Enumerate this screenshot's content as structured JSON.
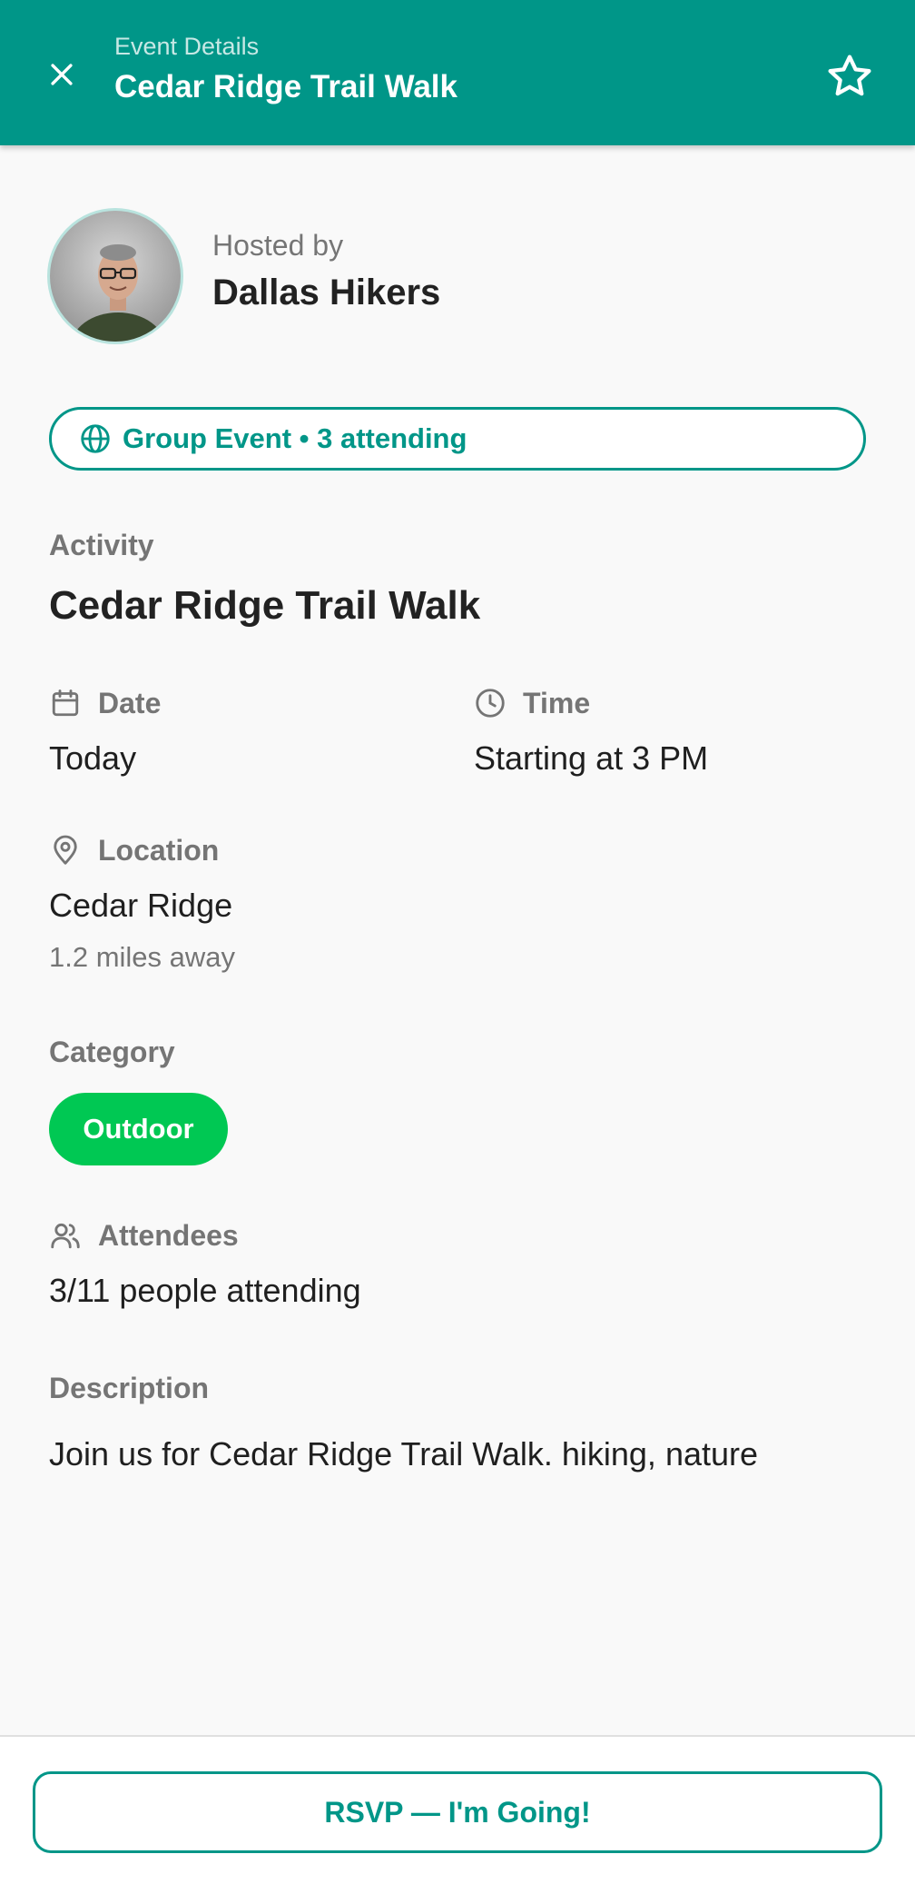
{
  "header": {
    "subtitle": "Event Details",
    "title": "Cedar Ridge Trail Walk",
    "close_icon": "close-icon",
    "star_icon": "star-outline-icon"
  },
  "host": {
    "label": "Hosted by",
    "name": "Dallas Hikers"
  },
  "group_badge": {
    "icon": "globe-icon",
    "text": "Group Event • 3 attending"
  },
  "activity": {
    "label": "Activity",
    "title": "Cedar Ridge Trail Walk"
  },
  "date": {
    "icon": "calendar-icon",
    "label": "Date",
    "value": "Today"
  },
  "time": {
    "icon": "clock-icon",
    "label": "Time",
    "value": "Starting at 3 PM"
  },
  "location": {
    "icon": "map-pin-icon",
    "label": "Location",
    "value": "Cedar Ridge",
    "distance": "1.2 miles away"
  },
  "category": {
    "label": "Category",
    "chip": "Outdoor"
  },
  "attendees": {
    "icon": "users-icon",
    "label": "Attendees",
    "value": "3/11 people attending"
  },
  "description": {
    "label": "Description",
    "text": "Join us for Cedar Ridge Trail Walk. hiking, nature"
  },
  "rsvp": {
    "label": "RSVP — I'm Going!"
  },
  "colors": {
    "primary": "#009688",
    "category": "#00c853",
    "background": "#f9f9f9"
  }
}
